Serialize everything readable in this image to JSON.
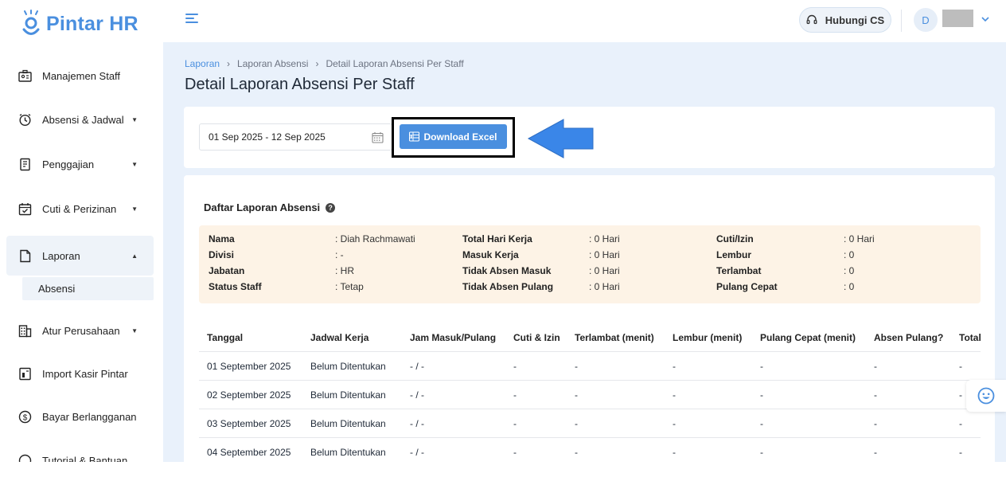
{
  "app": {
    "brand": "Pintar HR"
  },
  "sidebar": {
    "items": [
      {
        "label": "Manajemen Staff",
        "icon": "staff-id-icon"
      },
      {
        "label": "Absensi & Jadwal",
        "icon": "clock-icon"
      },
      {
        "label": "Penggajian",
        "icon": "payroll-icon"
      },
      {
        "label": "Cuti & Perizinan",
        "icon": "calendar-check-icon"
      },
      {
        "label": "Laporan",
        "icon": "report-icon"
      },
      {
        "label": "Atur Perusahaan",
        "icon": "building-icon"
      },
      {
        "label": "Import Kasir Pintar",
        "icon": "import-icon"
      },
      {
        "label": "Bayar Berlangganan",
        "icon": "dollar-icon"
      },
      {
        "label": "Tutorial & Bantuan",
        "icon": "help-icon"
      }
    ],
    "sub_item": "Absensi"
  },
  "topbar": {
    "cs_label": "Hubungi CS",
    "avatar_initial": "D"
  },
  "breadcrumb": [
    "Laporan",
    "Laporan Absensi",
    "Detail Laporan Absensi Per Staff"
  ],
  "page_title": "Detail Laporan Absensi Per Staff",
  "filter": {
    "date_range": "01 Sep 2025 - 12 Sep 2025",
    "download_label": "Download Excel"
  },
  "report": {
    "title": "Daftar Laporan Absensi",
    "info": {
      "nama_label": "Nama",
      "nama": ": Diah Rachmawati",
      "divisi_label": "Divisi",
      "divisi": ": -",
      "jabatan_label": "Jabatan",
      "jabatan": ": HR",
      "status_label": "Status Staff",
      "status": ": Tetap",
      "total_label": "Total Hari Kerja",
      "total": ": 0 Hari",
      "masuk_label": "Masuk Kerja",
      "masuk": ": 0 Hari",
      "tam_label": "Tidak Absen Masuk",
      "tam": ": 0 Hari",
      "tap_label": "Tidak Absen Pulang",
      "tap": ": 0 Hari",
      "cuti_label": "Cuti/Izin",
      "cuti": ": 0 Hari",
      "lembur_label": "Lembur",
      "lembur": ": 0",
      "terlambat_label": "Terlambat",
      "terlambat": ": 0",
      "pulang_label": "Pulang Cepat",
      "pulang": ": 0"
    },
    "columns": [
      "Tanggal",
      "Jadwal Kerja",
      "Jam Masuk/Pulang",
      "Cuti & Izin",
      "Terlambat (menit)",
      "Lembur (menit)",
      "Pulang Cepat (menit)",
      "Absen Pulang?",
      "Total"
    ],
    "rows": [
      [
        "01 September 2025",
        "Belum Ditentukan",
        "- / -",
        "-",
        "-",
        "-",
        "-",
        "-",
        "-"
      ],
      [
        "02 September 2025",
        "Belum Ditentukan",
        "- / -",
        "-",
        "-",
        "-",
        "-",
        "-",
        "-"
      ],
      [
        "03 September 2025",
        "Belum Ditentukan",
        "- / -",
        "-",
        "-",
        "-",
        "-",
        "-",
        "-"
      ],
      [
        "04 September 2025",
        "Belum Ditentukan",
        "- / -",
        "-",
        "-",
        "-",
        "-",
        "-",
        "-"
      ]
    ]
  },
  "colors": {
    "accent": "#4a8fdf",
    "background": "#e9f1fb",
    "info_bg": "#fdf3e6"
  }
}
